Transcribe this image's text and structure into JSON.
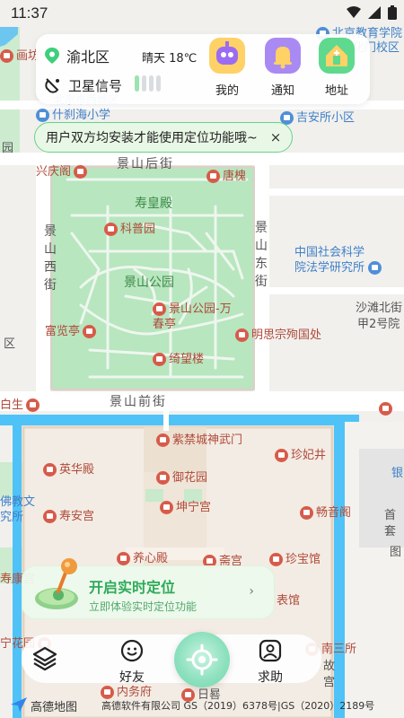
{
  "status_bar": {
    "time": "11:37"
  },
  "top_card": {
    "district": "渝北区",
    "weather": "晴天 18℃",
    "gps_label": "卫星信号",
    "shortcuts": [
      {
        "label": "我的",
        "icon": "profile-icon"
      },
      {
        "label": "通知",
        "icon": "notification-icon"
      },
      {
        "label": "地址",
        "icon": "address-icon"
      }
    ]
  },
  "hint": {
    "text": "用户双方均安装才能使用定位功能哦~",
    "close": "×"
  },
  "map": {
    "streets": {
      "jingshan_hou": "景山后街",
      "jingshan_qian": "景山前街",
      "jingshan_xi": "景山西街",
      "jingshan_dong": "景山东街"
    },
    "pois": {
      "shouhuangdian": "寿皇殿",
      "kepuyuan": "科普园",
      "tanghuai": "唐槐",
      "jingshan_park": "景山公园",
      "wanchunting": "景山公园-万春亭",
      "fulanting": "富览亭",
      "mingsizong": "明思宗殉国处",
      "jiwanglou": "绮望楼",
      "xingqingge": "兴庆阁",
      "zijincheng": "紫禁城神武门",
      "zhenfeijing": "珍妃井",
      "yinghuadian": "英华殿",
      "yuhuayuan": "御花园",
      "kunninggong": "坤宁宫",
      "shouangong": "寿安宫",
      "changyinge": "畅音阁",
      "yangxindian": "养心殿",
      "zhaigong": "斋宫",
      "zhenbaoguan": "珍宝馆",
      "biaoguan": "表馆",
      "nansansuo": "南三所",
      "neiwufu": "内务府",
      "shoukanggong": "寿康宫",
      "cininghuayuan": "宁花园",
      "beijing_edu": "北京教育学院",
      "huangchengmen": "黄化门校区",
      "shichahai": "什刹海小学",
      "beijing_xicheng": "北京市西城区",
      "jiansuo": "吉安所小区",
      "casslaw1": "中国社会科学",
      "casslaw2": "院法学研究所",
      "shatanbei1": "沙滩北街",
      "shatanbei2": "甲2号院",
      "huafang": "画坊",
      "baisheng": "白生",
      "fojiao": "佛教文",
      "fojiao2": "究所",
      "guqu": "区",
      "yuan": "园",
      "gugong": "故宫",
      "rizhao": "日晷",
      "gushou": "首套",
      "gushou2": "图",
      "yin": "银"
    }
  },
  "realtime_card": {
    "title": "开启实时定位",
    "subtitle": "立即体验实时定位功能",
    "arrow": "›"
  },
  "bottom_bar": {
    "friends": "好友",
    "help": "求助"
  },
  "footer": {
    "brand": "高德地图",
    "copyright": "高德软件有限公司  GS（2019）6378号|GS（2020）2189号"
  },
  "colors": {
    "accent_green": "#2faa5a",
    "park_green": "#b7e6bf",
    "water_blue": "#4fc3f7",
    "poi_red": "#d75b4a"
  }
}
